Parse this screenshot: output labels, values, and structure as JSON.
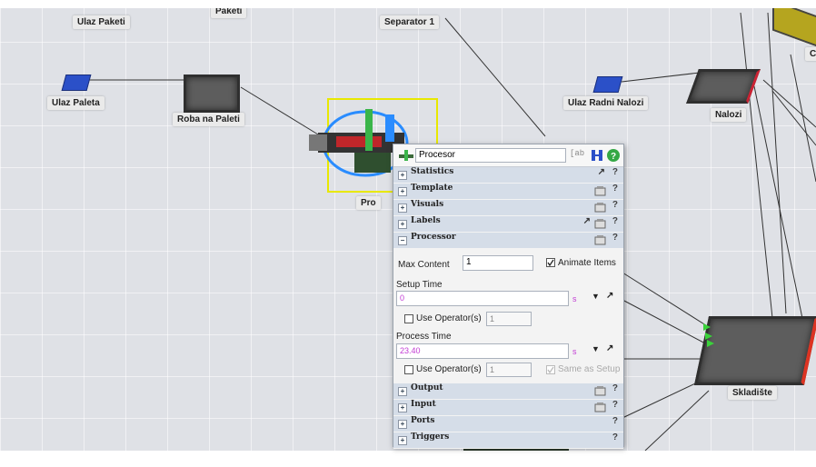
{
  "nodes": {
    "ulaz_paketi": "Ulaz Paketi",
    "paketi_partial": "Paketi",
    "separator": "Separator 1",
    "ulaz_paleta": "Ulaz Paleta",
    "roba_na_paleti": "Roba na Paleti",
    "ulaz_radni_nalozi": "Ulaz Radni Nalozi",
    "nalozi": "Nalozi",
    "skladiste": "Skladište",
    "procesor_partial": "Pro",
    "edge_partial": "C"
  },
  "panel": {
    "name": "Procesor",
    "sections_top": [
      "Statistics",
      "Template",
      "Visuals",
      "Labels",
      "Processor"
    ],
    "sections_bottom": [
      "Output",
      "Input",
      "Ports",
      "Triggers"
    ],
    "processor": {
      "max_content_label": "Max Content",
      "max_content": "1",
      "animate_items": "Animate Items",
      "setup_time_label": "Setup Time",
      "setup_time": "0",
      "unit": "s",
      "use_operators": "Use Operator(s)",
      "operators_count": "1",
      "process_time_label": "Process Time",
      "process_time": "23.40",
      "same_as_setup": "Same as Setup"
    }
  },
  "colors": {
    "value_text": "#c23bd4",
    "section_bg": "#d5dde8",
    "selection": "#e8e800"
  }
}
